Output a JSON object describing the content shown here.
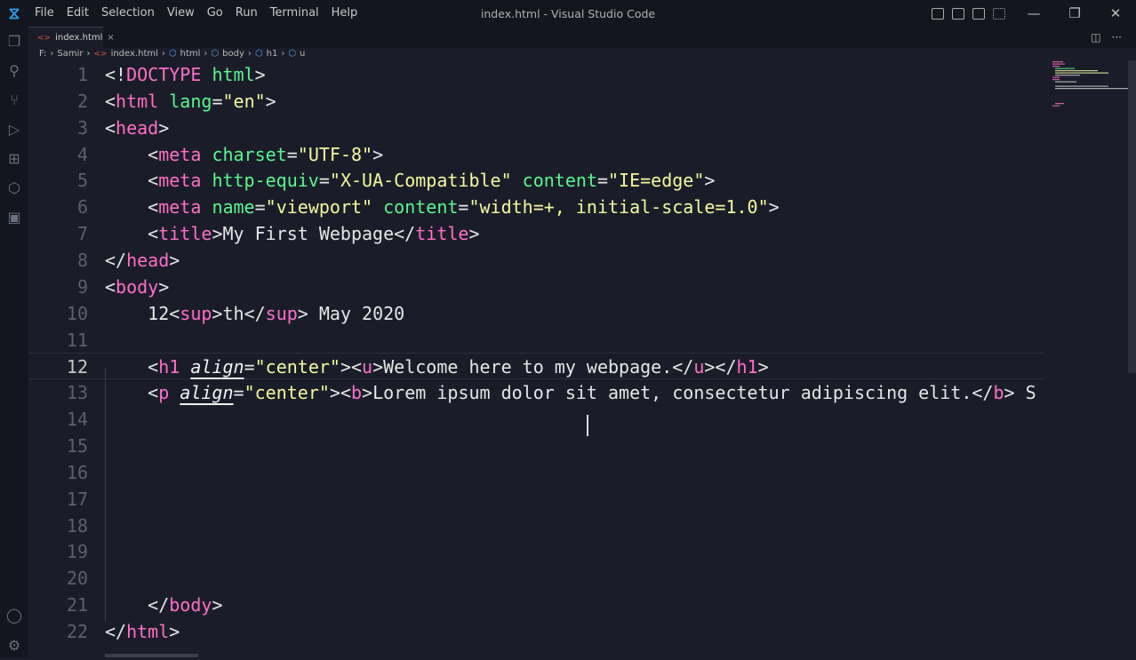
{
  "window": {
    "title": "index.html - Visual Studio Code"
  },
  "menu": [
    "File",
    "Edit",
    "Selection",
    "View",
    "Go",
    "Run",
    "Terminal",
    "Help"
  ],
  "tab": {
    "label": "index.html",
    "close": "×"
  },
  "breadcrumb": [
    "F:",
    "Samir",
    "index.html",
    "html",
    "body",
    "h1",
    "u"
  ],
  "colors": {
    "tag": "#ff6ec7",
    "attr": "#5af78e",
    "string": "#f3f99d",
    "bg": "#1a1d29"
  },
  "editor": {
    "current_line": 12,
    "lines": [
      [
        [
          "p",
          "<!"
        ],
        [
          "t",
          "DOCTYPE"
        ],
        [
          "x",
          " "
        ],
        [
          "a",
          "html"
        ],
        [
          "p",
          ">"
        ]
      ],
      [
        [
          "p",
          "<"
        ],
        [
          "t",
          "html"
        ],
        [
          "x",
          " "
        ],
        [
          "a",
          "lang"
        ],
        [
          "p",
          "="
        ],
        [
          "s",
          "\"en\""
        ],
        [
          "p",
          ">"
        ]
      ],
      [
        [
          "p",
          "<"
        ],
        [
          "t",
          "head"
        ],
        [
          "p",
          ">"
        ]
      ],
      [
        [
          "x",
          "    "
        ],
        [
          "p",
          "<"
        ],
        [
          "t",
          "meta"
        ],
        [
          "x",
          " "
        ],
        [
          "a",
          "charset"
        ],
        [
          "p",
          "="
        ],
        [
          "s",
          "\"UTF-8\""
        ],
        [
          "p",
          ">"
        ]
      ],
      [
        [
          "x",
          "    "
        ],
        [
          "p",
          "<"
        ],
        [
          "t",
          "meta"
        ],
        [
          "x",
          " "
        ],
        [
          "a",
          "http-equiv"
        ],
        [
          "p",
          "="
        ],
        [
          "s",
          "\"X-UA-Compatible\""
        ],
        [
          "x",
          " "
        ],
        [
          "a",
          "content"
        ],
        [
          "p",
          "="
        ],
        [
          "s",
          "\"IE=edge\""
        ],
        [
          "p",
          ">"
        ]
      ],
      [
        [
          "x",
          "    "
        ],
        [
          "p",
          "<"
        ],
        [
          "t",
          "meta"
        ],
        [
          "x",
          " "
        ],
        [
          "a",
          "name"
        ],
        [
          "p",
          "="
        ],
        [
          "s",
          "\"viewport\""
        ],
        [
          "x",
          " "
        ],
        [
          "a",
          "content"
        ],
        [
          "p",
          "="
        ],
        [
          "s",
          "\"width=+, initial-scale=1.0\""
        ],
        [
          "p",
          ">"
        ]
      ],
      [
        [
          "x",
          "    "
        ],
        [
          "p",
          "<"
        ],
        [
          "t",
          "title"
        ],
        [
          "p",
          ">"
        ],
        [
          "x",
          "My First Webpage"
        ],
        [
          "p",
          "</"
        ],
        [
          "t",
          "title"
        ],
        [
          "p",
          ">"
        ]
      ],
      [
        [
          "p",
          "</"
        ],
        [
          "t",
          "head"
        ],
        [
          "p",
          ">"
        ]
      ],
      [
        [
          "p",
          "<"
        ],
        [
          "t",
          "body"
        ],
        [
          "p",
          ">"
        ]
      ],
      [
        [
          "x",
          "    12"
        ],
        [
          "p",
          "<"
        ],
        [
          "t",
          "sup"
        ],
        [
          "p",
          ">"
        ],
        [
          "x",
          "th"
        ],
        [
          "p",
          "</"
        ],
        [
          "t",
          "sup"
        ],
        [
          "p",
          ">"
        ],
        [
          "x",
          " May 2020"
        ]
      ],
      [],
      [
        [
          "x",
          "    "
        ],
        [
          "p",
          "<"
        ],
        [
          "t",
          "h1"
        ],
        [
          "x",
          " "
        ],
        [
          "ai",
          "align"
        ],
        [
          "p",
          "="
        ],
        [
          "s",
          "\"center\""
        ],
        [
          "p",
          "><"
        ],
        [
          "t",
          "u"
        ],
        [
          "p",
          ">"
        ],
        [
          "x",
          "Welcome here to my webpage."
        ],
        [
          "p",
          "</"
        ],
        [
          "t",
          "u"
        ],
        [
          "p",
          "></"
        ],
        [
          "t",
          "h1"
        ],
        [
          "p",
          ">"
        ]
      ],
      [
        [
          "x",
          "    "
        ],
        [
          "p",
          "<"
        ],
        [
          "t",
          "p"
        ],
        [
          "x",
          " "
        ],
        [
          "ai",
          "align"
        ],
        [
          "p",
          "="
        ],
        [
          "s",
          "\"center\""
        ],
        [
          "p",
          "><"
        ],
        [
          "t",
          "b"
        ],
        [
          "p",
          ">"
        ],
        [
          "x",
          "Lorem ipsum dolor sit amet, consectetur adipiscing elit."
        ],
        [
          "p",
          "</"
        ],
        [
          "t",
          "b"
        ],
        [
          "p",
          ">"
        ],
        [
          "x",
          " S"
        ]
      ],
      [],
      [],
      [],
      [],
      [],
      [],
      [],
      [
        [
          "x",
          "    "
        ],
        [
          "p",
          "</"
        ],
        [
          "t",
          "body"
        ],
        [
          "p",
          ">"
        ]
      ],
      [
        [
          "p",
          "</"
        ],
        [
          "t",
          "html"
        ],
        [
          "p",
          ">"
        ]
      ]
    ]
  }
}
